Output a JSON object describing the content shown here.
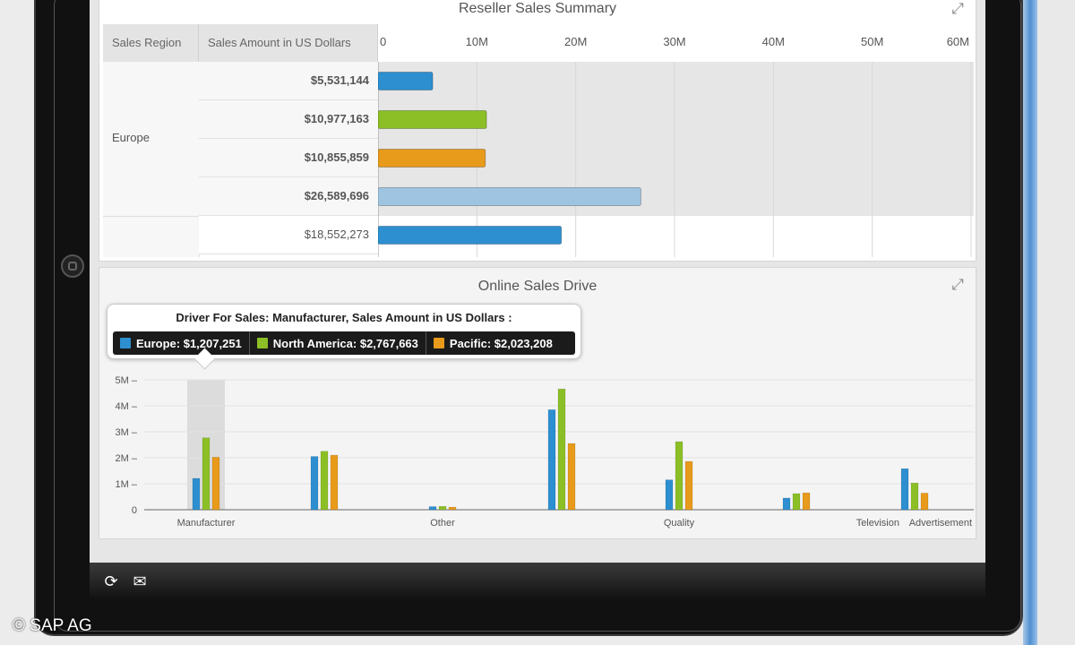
{
  "reseller": {
    "title": "Reseller Sales Summary",
    "headers": {
      "region": "Sales Region",
      "amount": "Sales Amount in US Dollars"
    },
    "region_label": "Europe",
    "rows": [
      {
        "amount": "$5,531,144",
        "value": 5531144,
        "color": "#2d8fd0"
      },
      {
        "amount": "$10,977,163",
        "value": 10977163,
        "color": "#8cbf26"
      },
      {
        "amount": "$10,855,859",
        "value": 10855859,
        "color": "#e89a1a"
      },
      {
        "amount": "$26,589,696",
        "value": 26589696,
        "color": "#9ec4e2"
      },
      {
        "amount": "$18,552,273",
        "value": 18552273,
        "color": "#2d8fd0"
      }
    ],
    "axis_ticks": [
      "0",
      "10M",
      "20M",
      "30M",
      "40M",
      "50M",
      "60M"
    ],
    "axis_max": 60000000
  },
  "online": {
    "title": "Online Sales Drive",
    "tooltip": {
      "title": "Driver For Sales: Manufacturer, Sales Amount in US Dollars :",
      "items": [
        {
          "label": "Europe: $1,207,251",
          "color": "#2d8fd0"
        },
        {
          "label": "North America: $2,767,663",
          "color": "#8cbf26"
        },
        {
          "label": "Pacific: $2,023,208",
          "color": "#e89a1a"
        }
      ]
    }
  },
  "chart_data": {
    "type": "bar",
    "title": "Online Sales Drive",
    "categories": [
      "Manufacturer",
      "",
      "Other",
      "",
      "Quality",
      "",
      "Television",
      "Advertisement"
    ],
    "series": [
      {
        "name": "Europe",
        "color": "#2d8fd0",
        "values": [
          1207251,
          2050000,
          120000,
          3850000,
          1150000,
          450000,
          1580000
        ]
      },
      {
        "name": "North America",
        "color": "#8cbf26",
        "values": [
          2767663,
          2250000,
          130000,
          4650000,
          2620000,
          620000,
          1030000
        ]
      },
      {
        "name": "Pacific",
        "color": "#e89a1a",
        "values": [
          2023208,
          2100000,
          100000,
          2550000,
          1860000,
          650000,
          640000
        ]
      }
    ],
    "yticks": [
      "0",
      "1M",
      "2M",
      "3M",
      "4M",
      "5M"
    ],
    "ylim": [
      0,
      5000000
    ],
    "x_tick_labels": [
      "Manufacturer",
      "Other",
      "Quality",
      "Television",
      "Advertisement"
    ],
    "highlighted_category": "Manufacturer"
  },
  "toolbar": {
    "refresh_icon": "refresh-icon",
    "mail_icon": "mail-icon"
  },
  "copyright": "© SAP AG"
}
